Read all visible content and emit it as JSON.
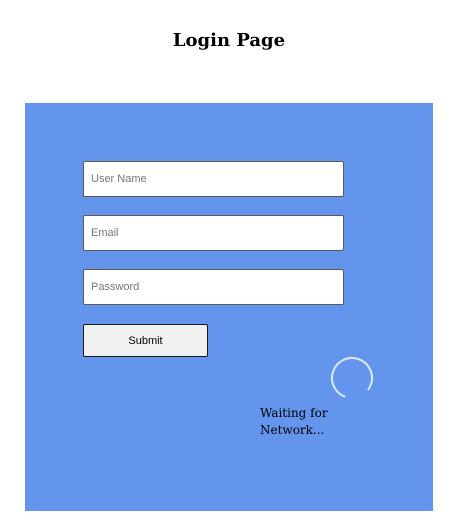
{
  "page": {
    "title": "Login Page"
  },
  "form": {
    "username": {
      "placeholder": "User Name",
      "value": ""
    },
    "email": {
      "placeholder": "Email",
      "value": ""
    },
    "password": {
      "placeholder": "Password",
      "value": ""
    },
    "submit_label": "Submit"
  },
  "status": {
    "message_line1": "Waiting for",
    "message_line2": "Network...",
    "spinner_icon": "loading-spinner-icon"
  },
  "colors": {
    "panel_background": "#6495ed",
    "spinner_ring": "#dce8ff"
  }
}
